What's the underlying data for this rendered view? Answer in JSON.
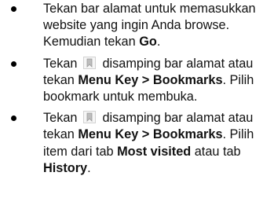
{
  "instructions": [
    {
      "t1": "Tekan bar alamat untuk memasukkan website yang ingin Anda browse. Kemudian tekan ",
      "b1": "Go",
      "t2": "."
    },
    {
      "t1": "Tekan",
      "icon": "bookmark-icon",
      "t2": "disamping bar alamat atau tekan ",
      "b1": "Menu Key > Bookmarks",
      "t3": ". Pilih bookmark untuk membuka."
    },
    {
      "t1": "Tekan",
      "icon": "bookmark-icon",
      "t2": "disamping bar alamat atau tekan ",
      "b1": "Menu Key > Bookmarks",
      "t3": ". Pilih item dari tab ",
      "b2": "Most visited",
      "t4": " atau tab ",
      "b3": "History",
      "t5": "."
    }
  ]
}
